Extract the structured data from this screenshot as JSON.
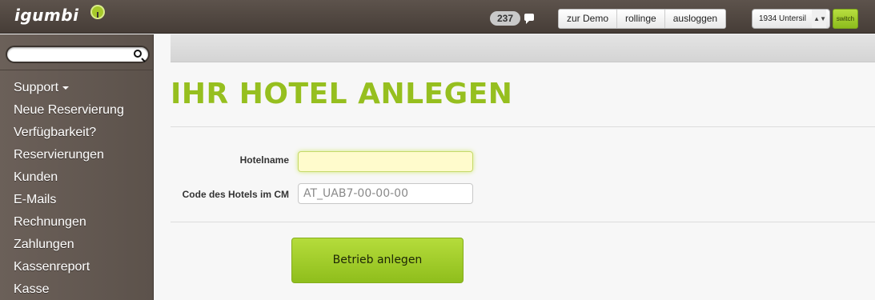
{
  "header": {
    "logo_text": "igumbi",
    "logo_icon": "tree-icon",
    "notification_count": "237",
    "chat_icon": "speech-bubble-icon",
    "buttons": [
      "zur Demo",
      "rollinge",
      "ausloggen"
    ],
    "select_value": "1934 Untersil",
    "switch_label": "switch"
  },
  "sidebar": {
    "search_placeholder": "",
    "search_icon": "search-icon",
    "items": [
      {
        "label": "Support",
        "has_caret": true
      },
      {
        "label": "Neue Reservierung"
      },
      {
        "label": "Verfügbarkeit?"
      },
      {
        "label": "Reservierungen"
      },
      {
        "label": "Kunden"
      },
      {
        "label": "E-Mails"
      },
      {
        "label": "Rechnungen"
      },
      {
        "label": "Zahlungen"
      },
      {
        "label": "Kassenreport"
      },
      {
        "label": "Kasse"
      }
    ]
  },
  "main": {
    "title": "IHR HOTEL ANLEGEN",
    "form": {
      "hotelname_label": "Hotelname",
      "hotelname_value": "",
      "code_label": "Code des Hotels im CM",
      "code_placeholder": "AT_UAB7-00-00-00",
      "submit_label": "Betrieb anlegen"
    }
  },
  "colors": {
    "accent_green": "#96bf1f",
    "sidebar_brown": "#6b6059",
    "topbar_brown": "#4f4640"
  }
}
